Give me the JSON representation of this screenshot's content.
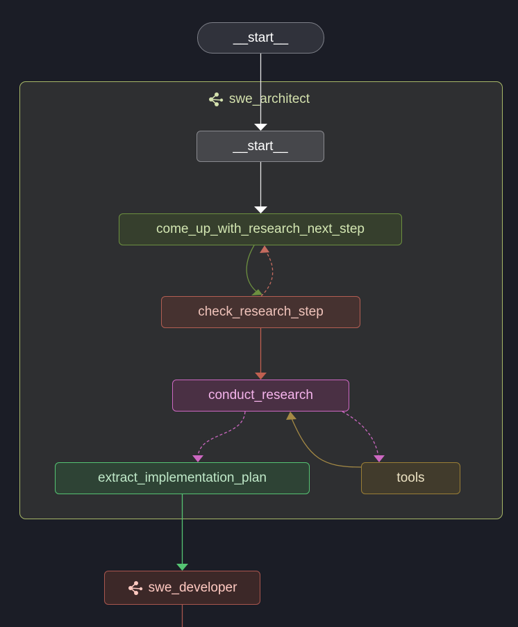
{
  "graph": {
    "start_outer": "__start__",
    "cluster_title": "swe_architect",
    "start_inner": "__start__",
    "nodes": {
      "come_up": "come_up_with_research_next_step",
      "check": "check_research_step",
      "conduct": "conduct_research",
      "extract": "extract_implementation_plan",
      "tools": "tools",
      "developer": "swe_developer"
    }
  },
  "colors": {
    "background": "#1b1d26",
    "cluster_border": "#a8b868",
    "come_up": "#6d9040",
    "check": "#b35e53",
    "conduct": "#cd68c2",
    "extract": "#55c473",
    "tools": "#9b7f36",
    "developer": "#a9564e"
  },
  "icons": {
    "cluster": "graph-network-icon",
    "developer": "graph-network-icon"
  }
}
